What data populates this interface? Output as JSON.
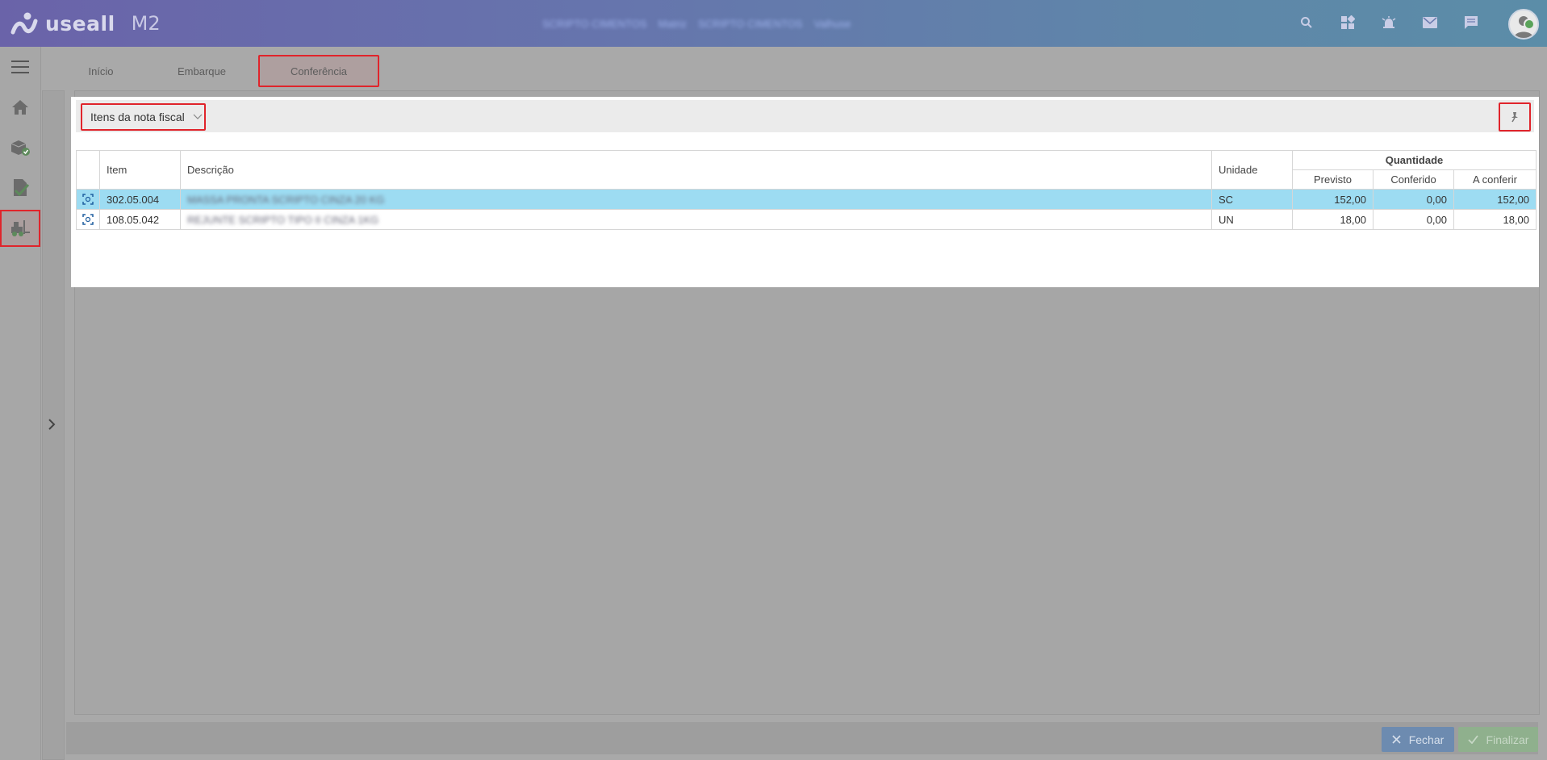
{
  "header": {
    "brand": "useall",
    "product": "M2",
    "user_info": [
      "SCRIPTO CIMENTOS",
      "Matriz",
      "SCRIPTO CIMENTOS",
      "Valhuse"
    ],
    "icons": [
      "search-icon",
      "apps-icon",
      "alarm-icon",
      "mail-icon",
      "chat-icon",
      "avatar"
    ]
  },
  "sidebar": {
    "items": [
      {
        "name": "menu-icon"
      },
      {
        "name": "home-icon"
      },
      {
        "name": "package-check-icon"
      },
      {
        "name": "document-check-icon"
      },
      {
        "name": "forklift-icon",
        "active": true
      }
    ]
  },
  "tabs": [
    {
      "label": "Início"
    },
    {
      "label": "Embarque"
    },
    {
      "label": "Conferência",
      "active": true
    }
  ],
  "panel": {
    "title": "Itens da nota fiscal",
    "columns": {
      "item": "Item",
      "descricao": "Descrição",
      "unidade": "Unidade",
      "quantidade": "Quantidade",
      "previsto": "Previsto",
      "conferido": "Conferido",
      "a_conferir": "A conferir"
    },
    "rows": [
      {
        "item": "302.05.004",
        "descricao": "MASSA PRONTA SCRIPTO CINZA 20 KG",
        "unidade": "SC",
        "previsto": "152,00",
        "conferido": "0,00",
        "a_conferir": "152,00",
        "selected": true
      },
      {
        "item": "108.05.042",
        "descricao": "REJUNTE SCRIPTO TIPO II CINZA 1KG",
        "unidade": "UN",
        "previsto": "18,00",
        "conferido": "0,00",
        "a_conferir": "18,00",
        "selected": false
      }
    ]
  },
  "footer": {
    "close_label": "Fechar",
    "finish_label": "Finalizar"
  },
  "colors": {
    "header_gradient_start": "#6a63a9",
    "header_gradient_end": "#5b8da8",
    "selected_row": "#9ddcf2",
    "highlight_border": "#e0242b",
    "close_button": "#6d8bb0",
    "finish_button": "#8fb08d"
  }
}
